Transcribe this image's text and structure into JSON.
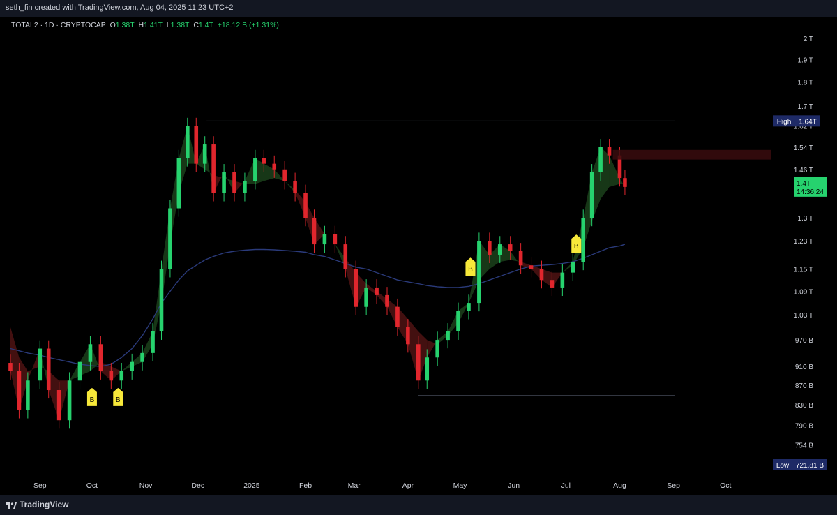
{
  "header": {
    "caption": "seth_fin created with TradingView.com, Aug 04, 2025 11:23 UTC+2"
  },
  "legend": {
    "symbol": "TOTAL2 · 1D · CRYPTOCAP",
    "o_label": "O",
    "o": "1.38T",
    "h_label": "H",
    "h": "1.41T",
    "l_label": "L",
    "l": "1.38T",
    "c_label": "C",
    "c": "1.4T",
    "change": "+18.12 B (+1.31%)"
  },
  "footer": {
    "brand": "TradingView"
  },
  "colors": {
    "up": "#26d26e",
    "down": "#e0262d",
    "ma_line": "#2a3a7a",
    "badge": "#f7e83a",
    "high_tag": "#1e2a66",
    "price_tag": "#26d26e"
  },
  "chart_data": {
    "type": "candlestick",
    "symbol": "TOTAL2",
    "timeframe": "1D",
    "x": [
      "2024-08-15",
      "2024-08-20",
      "2024-08-25",
      "2024-09-01",
      "2024-09-06",
      "2024-09-12",
      "2024-09-18",
      "2024-09-24",
      "2024-09-30",
      "2024-10-06",
      "2024-10-12",
      "2024-10-18",
      "2024-10-24",
      "2024-10-30",
      "2024-11-05",
      "2024-11-10",
      "2024-11-15",
      "2024-11-20",
      "2024-11-25",
      "2024-11-30",
      "2024-12-05",
      "2024-12-10",
      "2024-12-16",
      "2024-12-22",
      "2024-12-28",
      "2025-01-03",
      "2025-01-08",
      "2025-01-14",
      "2025-01-20",
      "2025-01-26",
      "2025-02-01",
      "2025-02-06",
      "2025-02-12",
      "2025-02-18",
      "2025-02-24",
      "2025-03-02",
      "2025-03-08",
      "2025-03-14",
      "2025-03-20",
      "2025-03-26",
      "2025-04-01",
      "2025-04-07",
      "2025-04-12",
      "2025-04-18",
      "2025-04-24",
      "2025-04-30",
      "2025-05-06",
      "2025-05-12",
      "2025-05-18",
      "2025-05-24",
      "2025-05-30",
      "2025-06-05",
      "2025-06-11",
      "2025-06-17",
      "2025-06-23",
      "2025-06-29",
      "2025-07-05",
      "2025-07-11",
      "2025-07-16",
      "2025-07-21",
      "2025-07-26",
      "2025-08-01",
      "2025-08-04"
    ],
    "close": [
      900,
      820,
      880,
      950,
      860,
      800,
      880,
      920,
      960,
      900,
      880,
      900,
      920,
      940,
      990,
      1150,
      1330,
      1500,
      1620,
      1480,
      1550,
      1380,
      1450,
      1380,
      1420,
      1500,
      1480,
      1460,
      1420,
      1380,
      1300,
      1220,
      1250,
      1220,
      1150,
      1050,
      1100,
      1080,
      1050,
      1000,
      960,
      880,
      930,
      970,
      990,
      1040,
      1060,
      1230,
      1190,
      1220,
      1200,
      1160,
      1150,
      1120,
      1100,
      1140,
      1170,
      1300,
      1450,
      1540,
      1510,
      1430,
      1400
    ],
    "series": [
      {
        "name": "",
        "values": [
          1000,
          930,
          900,
          910,
          900,
          880,
          880,
          890,
          900,
          920,
          910,
          900,
          910,
          920,
          960,
          1060,
          1220,
          1380,
          1480,
          1480,
          1460,
          1440,
          1430,
          1420,
          1410,
          1410,
          1420,
          1430,
          1420,
          1390,
          1350,
          1300,
          1250,
          1220,
          1180,
          1140,
          1110,
          1090,
          1070,
          1050,
          1020,
          990,
          970,
          960,
          980,
          1010,
          1060,
          1120,
          1150,
          1170,
          1175,
          1170,
          1160,
          1150,
          1140,
          1140,
          1160,
          1210,
          1290,
          1360,
          1400,
          1410,
          1410
        ]
      },
      {
        "name": "",
        "values": [
          950,
          945,
          940,
          935,
          930,
          925,
          920,
          915,
          912,
          910,
          915,
          930,
          950,
          980,
          1020,
          1060,
          1090,
          1120,
          1145,
          1160,
          1175,
          1185,
          1195,
          1200,
          1203,
          1205,
          1205,
          1204,
          1202,
          1200,
          1197,
          1190,
          1185,
          1175,
          1165,
          1155,
          1150,
          1140,
          1130,
          1120,
          1115,
          1110,
          1105,
          1102,
          1100,
          1100,
          1103,
          1110,
          1120,
          1130,
          1140,
          1150,
          1158,
          1160,
          1162,
          1165,
          1170,
          1180,
          1190,
          1200,
          1210,
          1215,
          1220
        ]
      }
    ],
    "y_ticks": [
      "2 T",
      "1.9 T",
      "1.8 T",
      "1.7 T",
      "1.62 T",
      "1.54 T",
      "1.46 T",
      "1.3 T",
      "1.23 T",
      "1.15 T",
      "1.09 T",
      "1.03 T",
      "970 B",
      "910 B",
      "870 B",
      "830 B",
      "790 B",
      "754 B"
    ],
    "y_tick_values": [
      2000,
      1900,
      1800,
      1700,
      1620,
      1540,
      1460,
      1300,
      1230,
      1150,
      1090,
      1030,
      970,
      910,
      870,
      830,
      790,
      754
    ],
    "ylim": [
      700,
      2050
    ],
    "y_scale": "log",
    "x_ticks": [
      {
        "label": "Sep",
        "date": "2024-09-01"
      },
      {
        "label": "Oct",
        "date": "2024-10-01"
      },
      {
        "label": "Nov",
        "date": "2024-11-01"
      },
      {
        "label": "Dec",
        "date": "2024-12-01"
      },
      {
        "label": "2025",
        "date": "2025-01-01"
      },
      {
        "label": "Feb",
        "date": "2025-02-01"
      },
      {
        "label": "Mar",
        "date": "2025-03-01"
      },
      {
        "label": "Apr",
        "date": "2025-04-01"
      },
      {
        "label": "May",
        "date": "2025-05-01"
      },
      {
        "label": "Jun",
        "date": "2025-06-01"
      },
      {
        "label": "Jul",
        "date": "2025-07-01"
      },
      {
        "label": "Aug",
        "date": "2025-08-01"
      },
      {
        "label": "Sep",
        "date": "2025-09-01"
      },
      {
        "label": "Oct",
        "date": "2025-10-01"
      }
    ],
    "xlim": [
      "2024-08-13",
      "2025-10-25"
    ],
    "high": {
      "label": "High",
      "value": "1.64T",
      "y": 1640
    },
    "low": {
      "label": "Low",
      "value": "721.81 B",
      "y": 721.81
    },
    "last_price": {
      "value": "1.4T",
      "countdown": "14:36:24",
      "y": 1400
    },
    "resistance_zone": {
      "date_from": "2025-07-28",
      "from": 1495,
      "to": 1530
    },
    "buy_signals": [
      {
        "label": "B",
        "date": "2024-10-01"
      },
      {
        "label": "B",
        "date": "2024-10-16"
      },
      {
        "label": "B",
        "date": "2025-05-07"
      },
      {
        "label": "B",
        "date": "2025-07-07"
      }
    ],
    "grid": false
  }
}
